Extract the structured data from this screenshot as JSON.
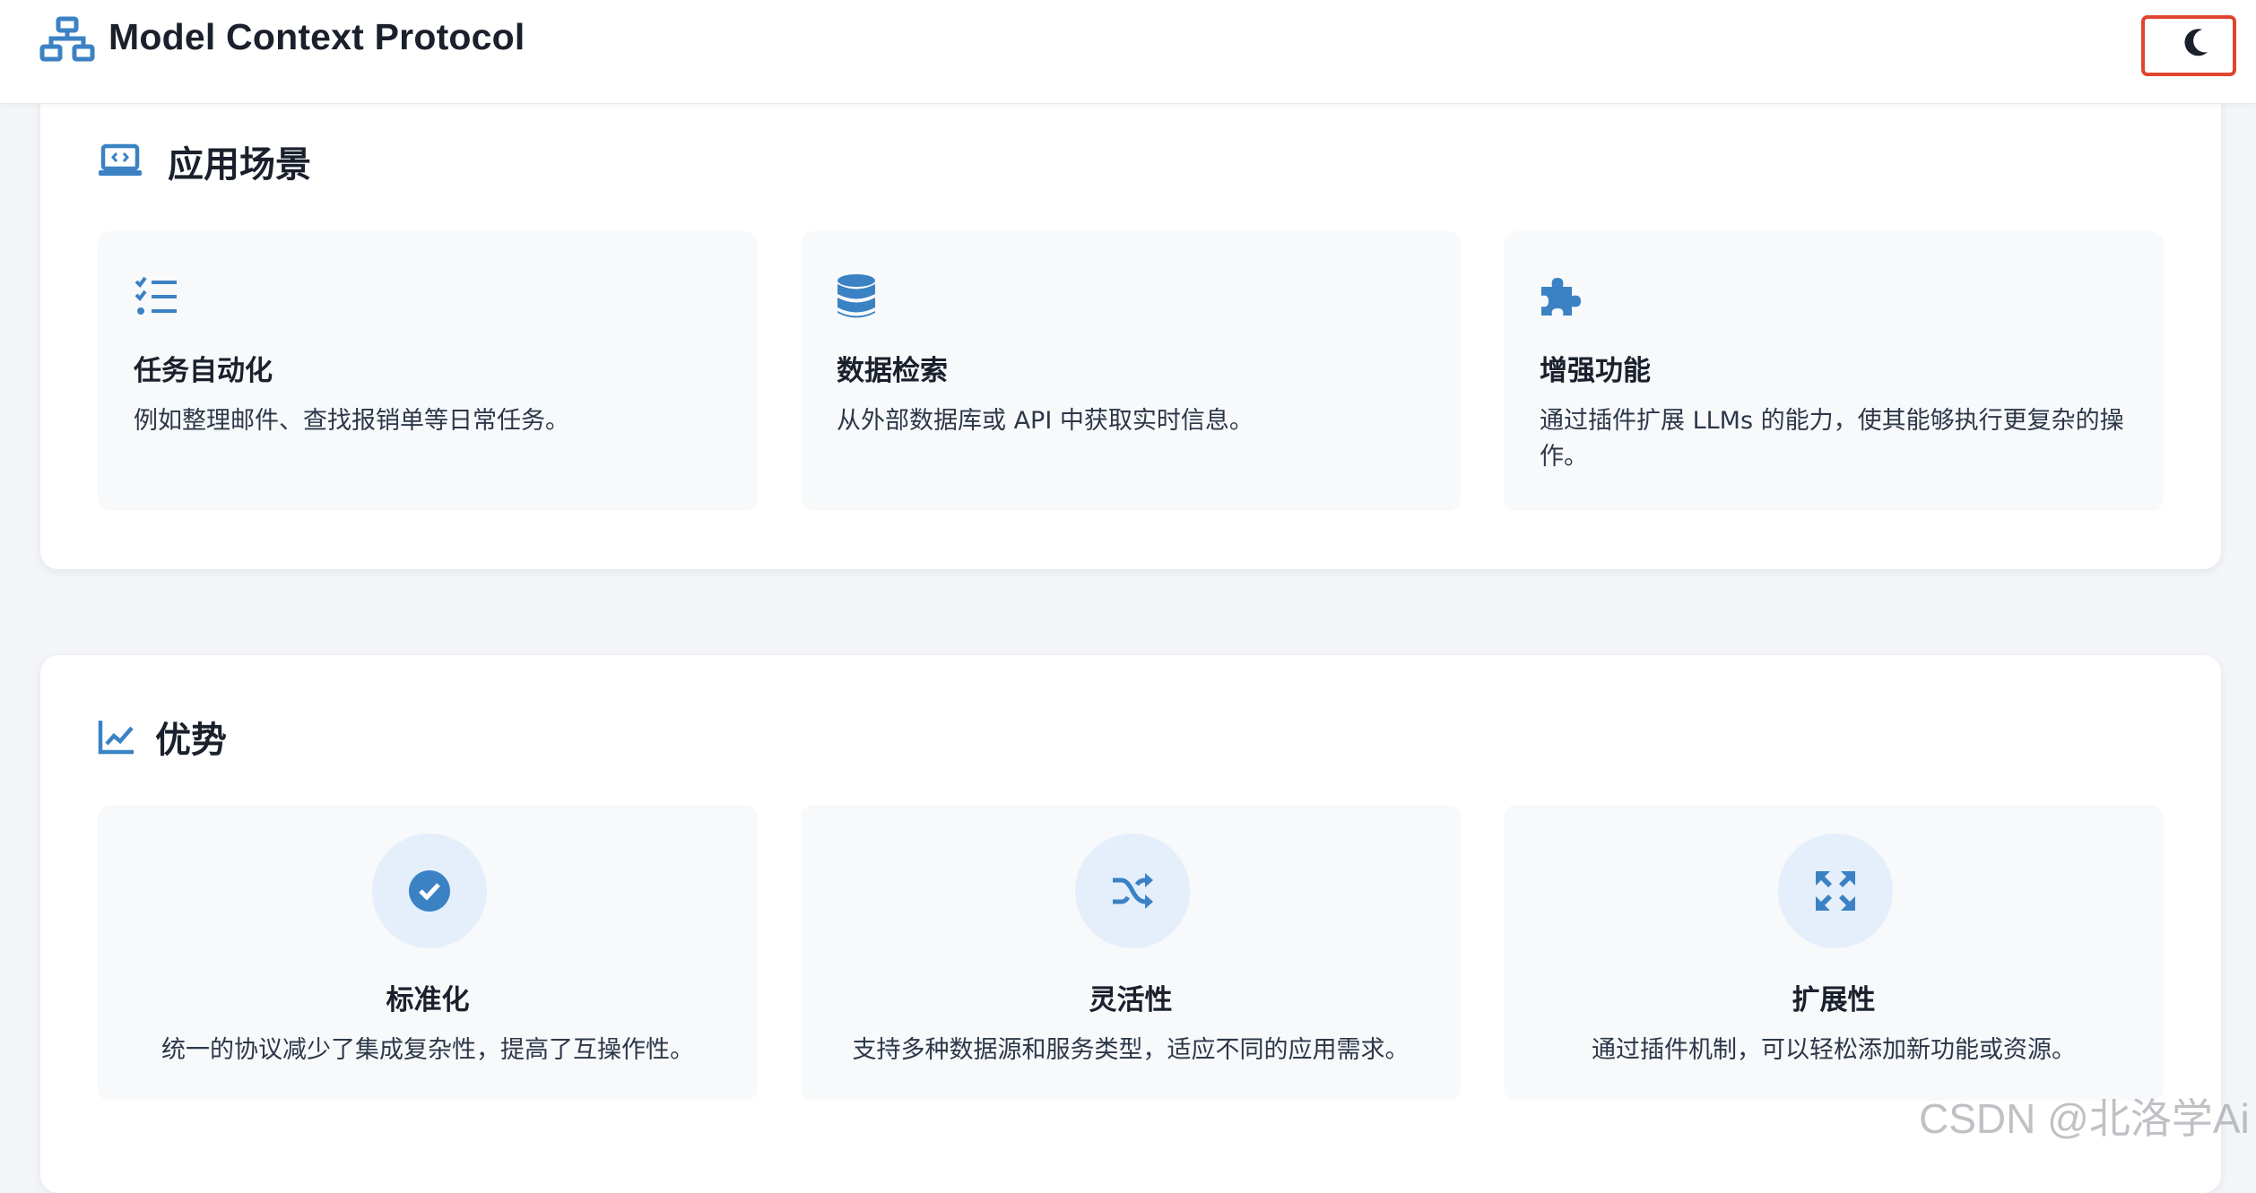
{
  "header": {
    "title": "Model Context Protocol",
    "brand_icon": "network-icon",
    "theme_toggle_icon": "moon-icon"
  },
  "use_cases": {
    "icon": "laptop-code-icon",
    "title": "应用场景",
    "cards": [
      {
        "icon": "task-list-icon",
        "title": "任务自动化",
        "desc": "例如整理邮件、查找报销单等日常任务。"
      },
      {
        "icon": "database-icon",
        "title": "数据检索",
        "desc": "从外部数据库或 API 中获取实时信息。"
      },
      {
        "icon": "puzzle-icon",
        "title": "增强功能",
        "desc": "通过插件扩展 LLMs 的能力，使其能够执行更复杂的操作。"
      }
    ]
  },
  "advantages": {
    "icon": "chart-line-icon",
    "title": "优势",
    "cards": [
      {
        "icon": "check-circle-icon",
        "title": "标准化",
        "desc": "统一的协议减少了集成复杂性，提高了互操作性。"
      },
      {
        "icon": "shuffle-icon",
        "title": "灵活性",
        "desc": "支持多种数据源和服务类型，适应不同的应用需求。"
      },
      {
        "icon": "expand-arrows-icon",
        "title": "扩展性",
        "desc": "通过插件机制，可以轻松添加新功能或资源。"
      }
    ]
  },
  "watermark": "CSDN @北洛学Ai",
  "colors": {
    "accent": "#3b82c4",
    "toggle_border": "#e0452f",
    "card_bg": "#f7f9fb",
    "circle_bg": "#e4effb"
  }
}
